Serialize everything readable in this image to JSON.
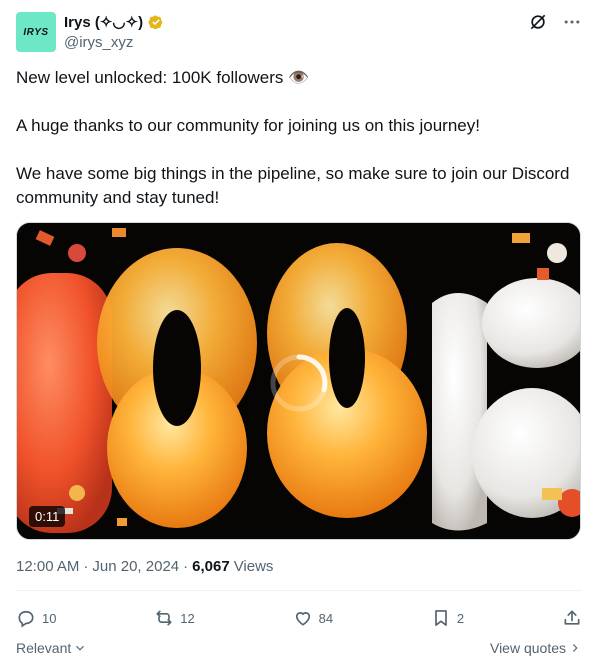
{
  "author": {
    "avatar_text": "IRYS",
    "display_name": "Irys (✧◡✧)",
    "handle": "@irys_xyz",
    "verified": true,
    "avatar_color": "#6ee7c6"
  },
  "header_icons": [
    "grok-icon",
    "more-icon"
  ],
  "tweet": {
    "line1": "New level unlocked: 100K followers 👁️",
    "line2": "A huge thanks to our community for joining us on this journey!",
    "line3": "We have some big things in the pipeline, so make sure to join our Discord community and stay tuned!"
  },
  "media": {
    "type": "video",
    "duration": "0:11",
    "loading": true
  },
  "meta": {
    "time": "12:00 AM",
    "separator": "·",
    "date": "Jun 20, 2024",
    "views_count": "6,067",
    "views_label": "Views"
  },
  "actions": {
    "replies": "10",
    "reposts": "12",
    "likes": "84",
    "bookmarks": "2"
  },
  "footer": {
    "sort_label": "Relevant",
    "quotes_label": "View quotes"
  },
  "colors": {
    "text": "#0f1419",
    "secondary": "#536471",
    "verified_gold": "#e2b719"
  }
}
